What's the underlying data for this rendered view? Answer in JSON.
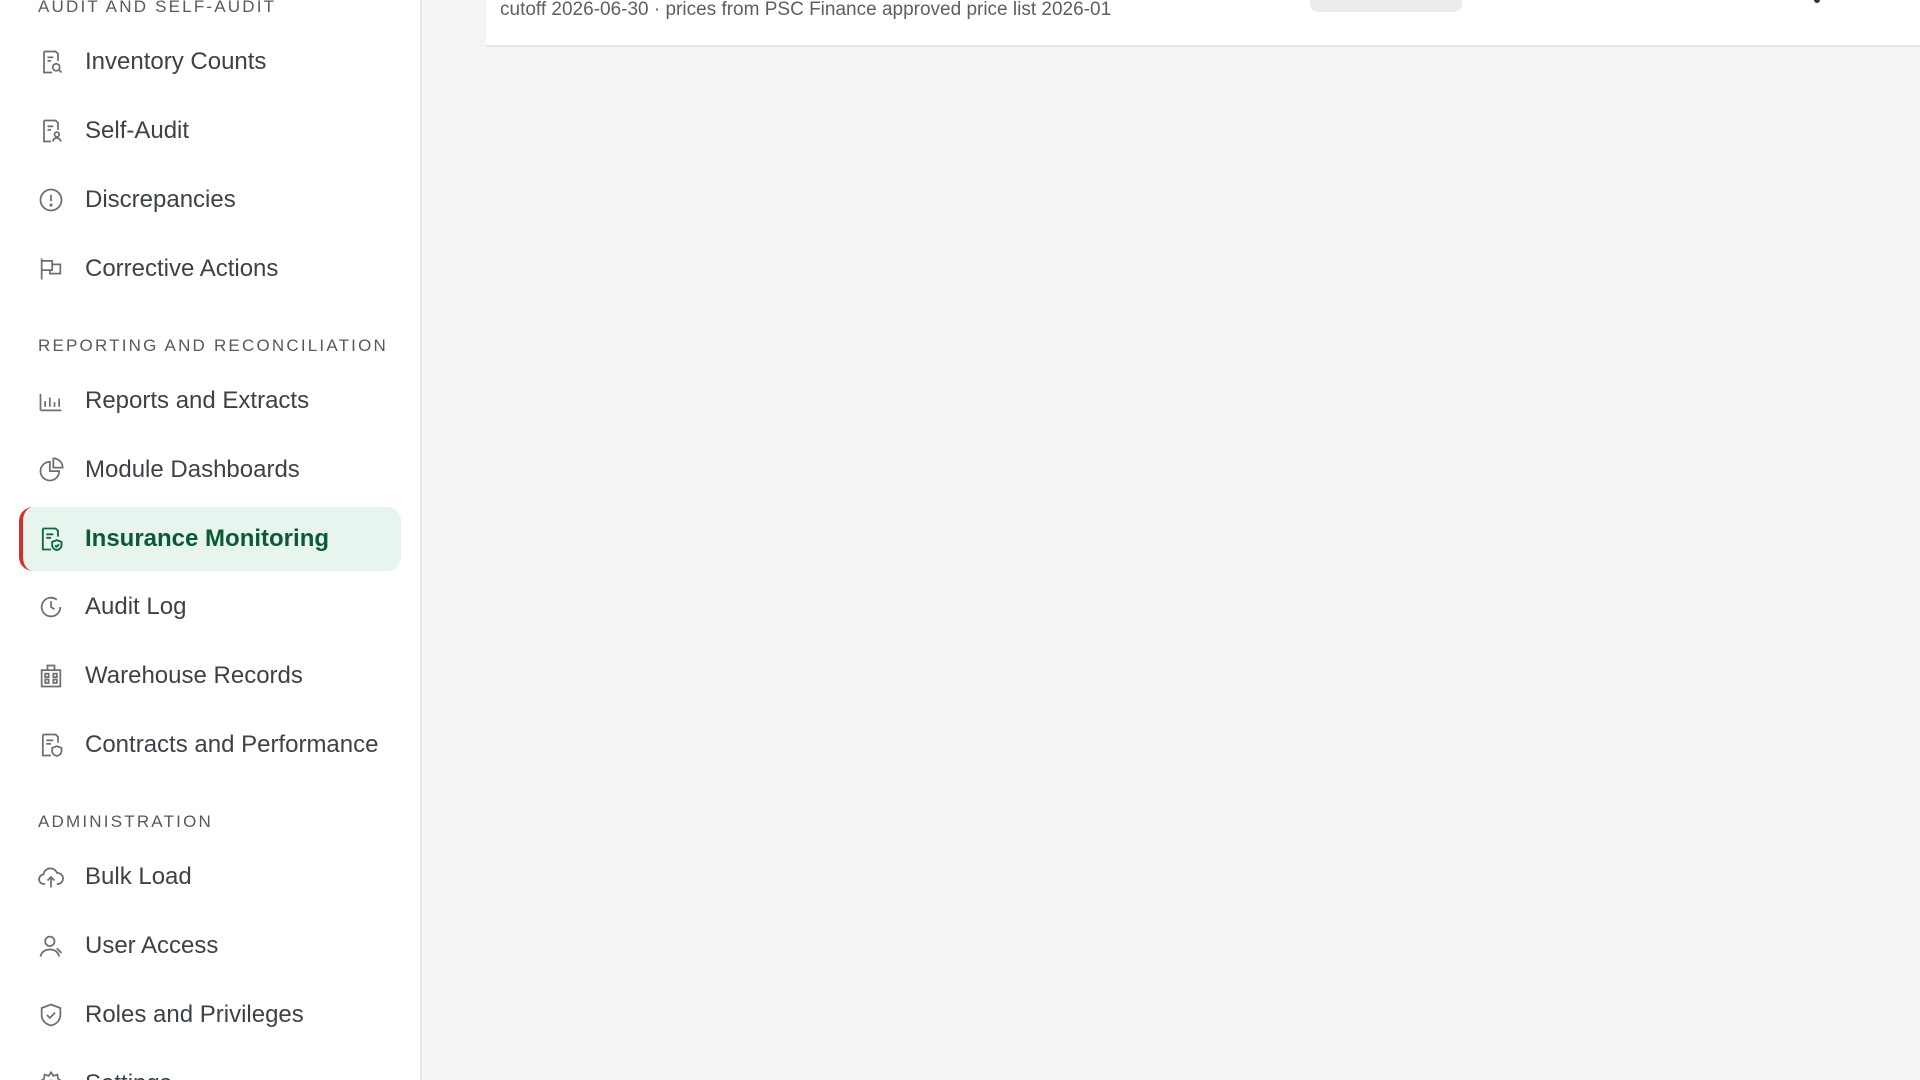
{
  "sidebar": {
    "sections": [
      {
        "heading": "AUDIT AND SELF-AUDIT",
        "items": [
          {
            "label": "Inventory Counts",
            "icon": "inventory-counts-icon"
          },
          {
            "label": "Self-Audit",
            "icon": "self-audit-icon"
          },
          {
            "label": "Discrepancies",
            "icon": "alert-circle-icon"
          },
          {
            "label": "Corrective Actions",
            "icon": "flag-icon"
          }
        ]
      },
      {
        "heading": "REPORTING AND RECONCILIATION",
        "items": [
          {
            "label": "Reports and Extracts",
            "icon": "bar-chart-icon"
          },
          {
            "label": "Module Dashboards",
            "icon": "pie-chart-icon"
          },
          {
            "label": "Insurance Monitoring",
            "icon": "document-shield-icon",
            "active": true
          },
          {
            "label": "Audit Log",
            "icon": "history-clock-icon"
          },
          {
            "label": "Warehouse Records",
            "icon": "building-icon"
          },
          {
            "label": "Contracts and Performance",
            "icon": "contract-shield-icon"
          }
        ]
      },
      {
        "heading": "ADMINISTRATION",
        "items": [
          {
            "label": "Bulk Load",
            "icon": "cloud-upload-icon"
          },
          {
            "label": "User Access",
            "icon": "user-icon"
          },
          {
            "label": "Roles and Privileges",
            "icon": "shield-icon"
          },
          {
            "label": "Settings",
            "icon": "gear-icon"
          }
        ]
      }
    ]
  },
  "main": {
    "subtitle": "cutoff 2026-06-30 · prices from PSC Finance approved price list 2026-01"
  },
  "colors": {
    "accent": "#0b5a34",
    "active_bg": "#e8f4ee",
    "active_marker": "#d32f2f"
  }
}
